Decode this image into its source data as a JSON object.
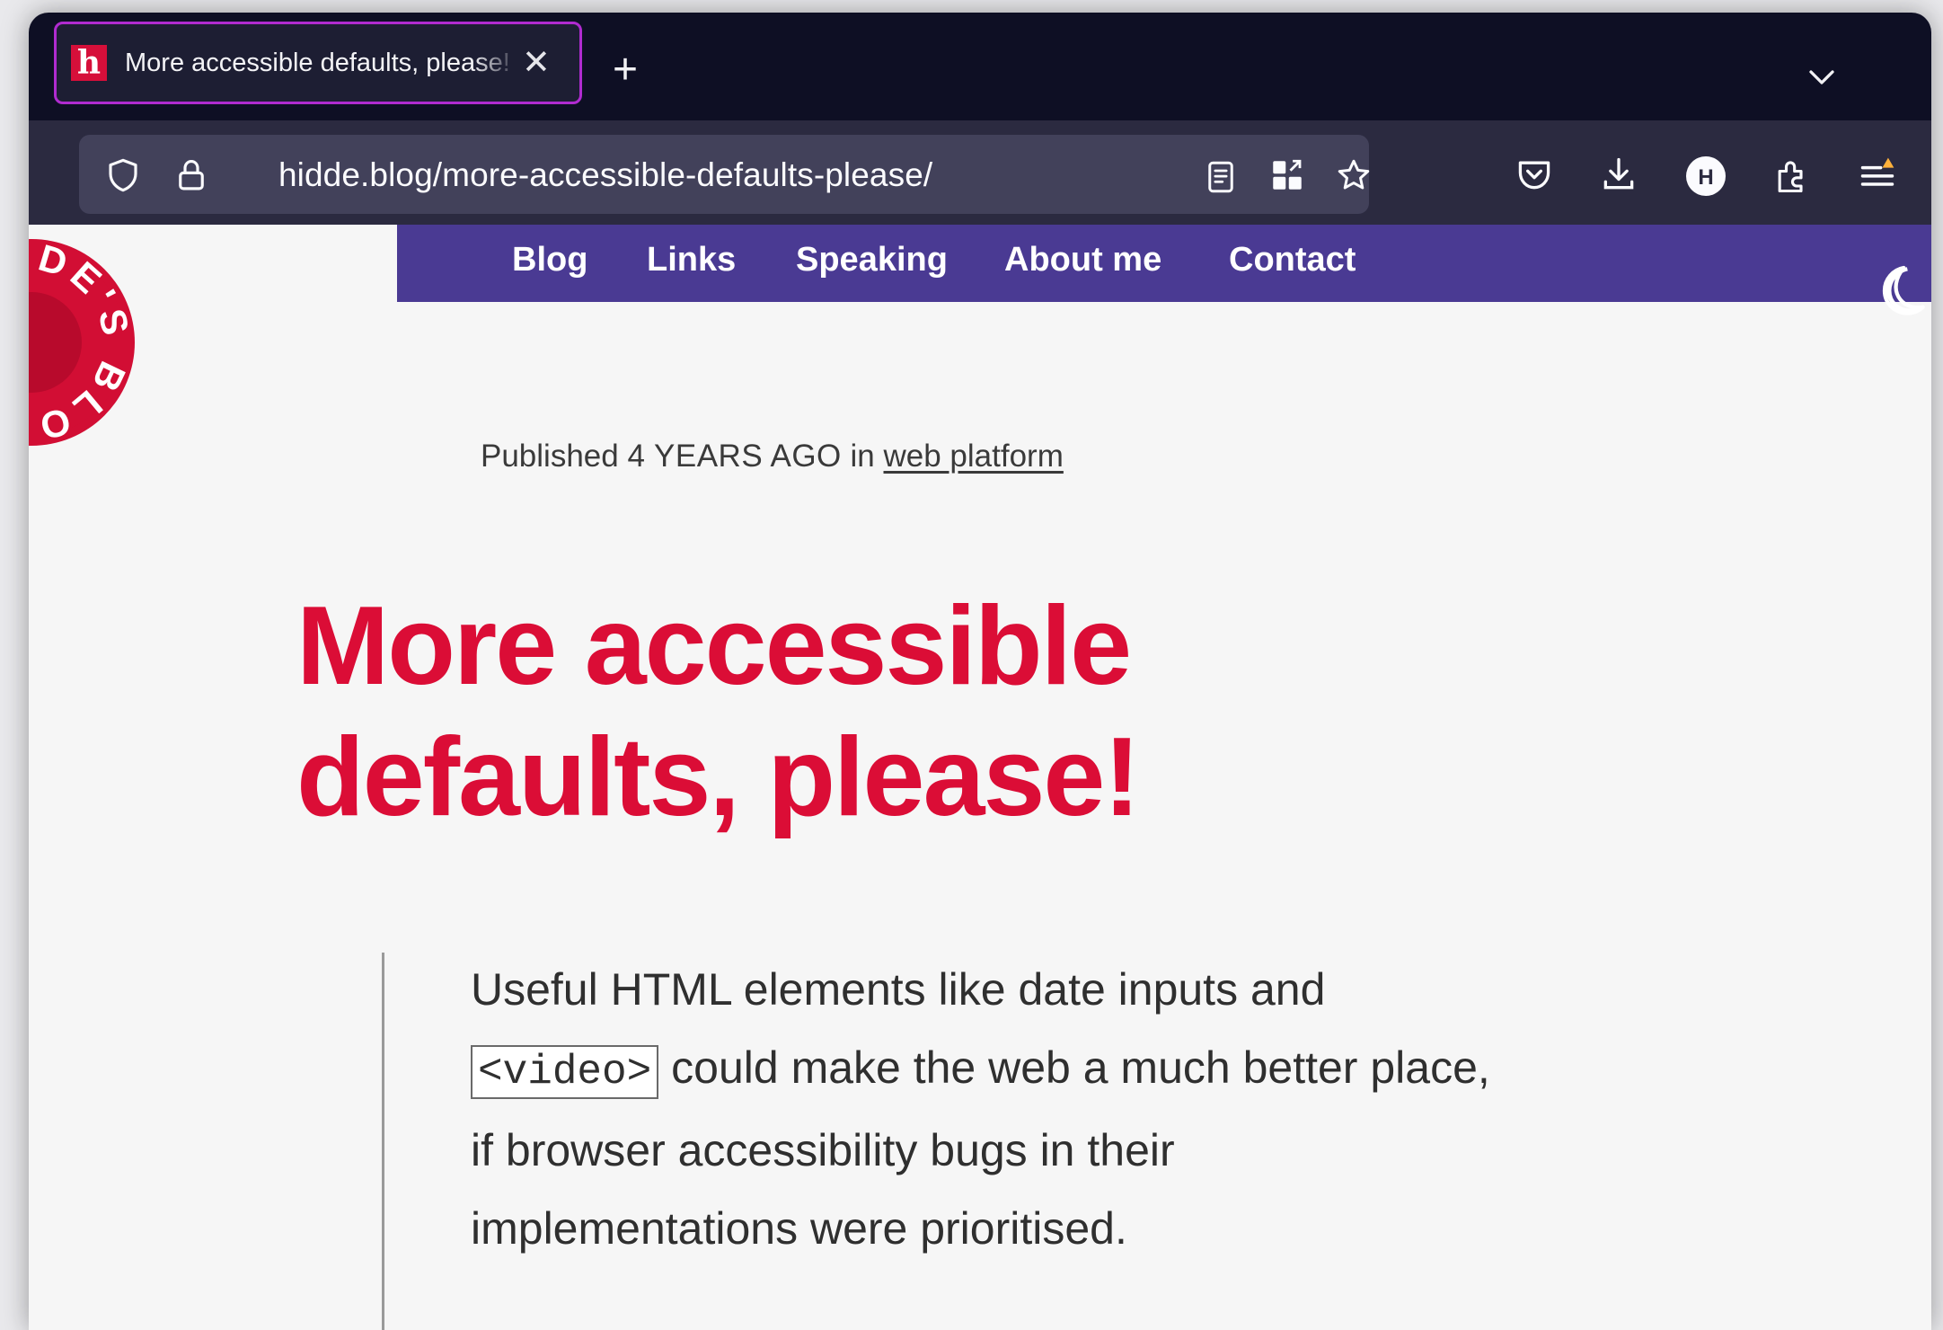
{
  "browser": {
    "tab": {
      "favicon_letter": "h",
      "title": "More accessible defaults, please!",
      "close_glyph": "✕"
    },
    "new_tab_glyph": "+",
    "url": "hidde.blog/more-accessible-defaults-please/",
    "icons": {
      "tracking_protection": "shield-icon",
      "connection": "lock-icon",
      "reader_view": "reader-view-icon",
      "qr": "qr-code-icon",
      "bookmark": "star-icon",
      "pocket": "pocket-icon",
      "downloads": "download-icon",
      "account": "account-icon",
      "extensions": "extensions-icon",
      "menu": "menu-icon"
    },
    "account_initial": "H",
    "accent_color": "#b02bd0"
  },
  "site": {
    "nav": [
      {
        "label": "Blog"
      },
      {
        "label": "Links"
      },
      {
        "label": "Speaking"
      },
      {
        "label": "About me"
      },
      {
        "label": "Contact"
      }
    ],
    "logo_text": "HIDDE'S BLOG",
    "theme_toggle_icon": "moon-icon",
    "nav_color": "#4a3a93",
    "brand_color": "#db0d36"
  },
  "article": {
    "meta_prefix": "Published",
    "meta_when": "4 YEARS AGO",
    "meta_in": "in",
    "meta_category": "web platform",
    "title": "More accessible defaults, please!",
    "intro_before": "Useful HTML elements like date inputs and",
    "intro_code": "<video>",
    "intro_after": "could make the web a much better place, if browser accessibility bugs in their implementations were prioritised."
  }
}
